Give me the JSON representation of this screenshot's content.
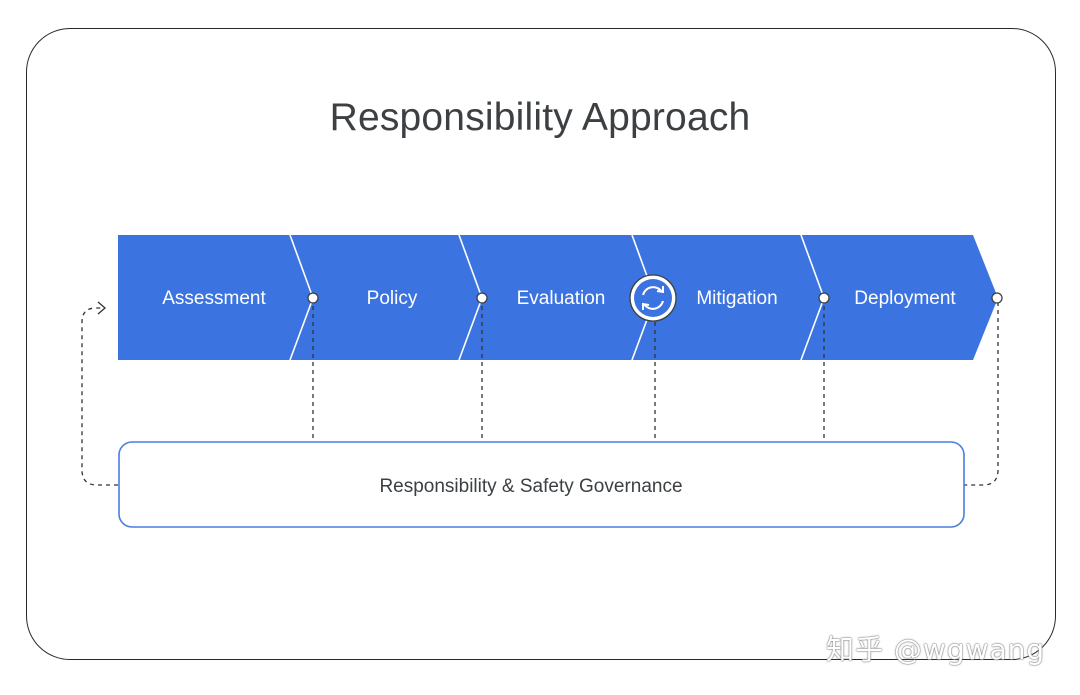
{
  "title": "Responsibility Approach",
  "stages": [
    {
      "label": "Assessment"
    },
    {
      "label": "Policy"
    },
    {
      "label": "Evaluation"
    },
    {
      "label": "Mitigation"
    },
    {
      "label": "Deployment"
    }
  ],
  "governance": {
    "label": "Responsibility & Safety Governance"
  },
  "cycle_icon": "refresh-cycle-icon",
  "colors": {
    "band": "#3b73e0",
    "governance_border": "#4a7fe0",
    "text": "#3c4043"
  },
  "watermark": "知乎 @wgwang"
}
